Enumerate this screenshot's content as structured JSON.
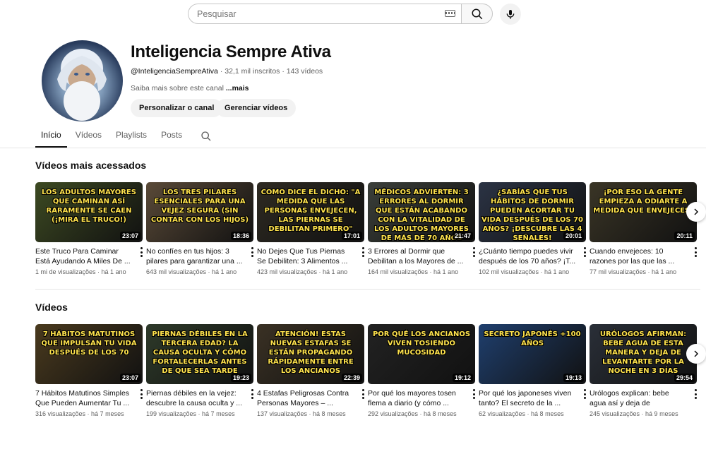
{
  "search": {
    "placeholder": "Pesquisar"
  },
  "channel": {
    "title": "Inteligencia Sempre Ativa",
    "handle": "@InteligenciaSempreAtiva",
    "subscribers": "32,1 mil inscritos",
    "videos_count": "143 vídeos",
    "description": "Saiba mais sobre este canal",
    "more": "...mais",
    "customize_button": "Personalizar o canal",
    "manage_button": "Gerenciar vídeos"
  },
  "tabs": [
    {
      "label": "Início",
      "active": true
    },
    {
      "label": "Vídeos",
      "active": false
    },
    {
      "label": "Playlists",
      "active": false
    },
    {
      "label": "Posts",
      "active": false
    }
  ],
  "sections": [
    {
      "title": "Vídeos mais acessados",
      "videos": [
        {
          "thumb_text": "Los adultos mayores que caminan así raramente se caen (¡mira el truco!)",
          "duration": "23:07",
          "title": "Este Truco Para Caminar Está Ayudando A Miles De ...",
          "views": "1 mi de visualizações",
          "age": "há 1 ano",
          "bg": "#3d4a22"
        },
        {
          "thumb_text": "Los tres pilares esenciales para una vejez segura (sin contar con los hijos)",
          "duration": "18:36",
          "title": "No confíes en tus hijos: 3 pilares para garantizar una ...",
          "views": "643 mil visualizações",
          "age": "há 1 ano",
          "bg": "#5a4a38"
        },
        {
          "thumb_text": "Como dice el dicho: \"A medida que las personas envejecen, las piernas se debilitan primero\"",
          "duration": "17:01",
          "title": "No Dejes Que Tus Piernas Se Debiliten: 3 Alimentos ...",
          "views": "423 mil visualizações",
          "age": "há 1 ano",
          "bg": "#2e2a22"
        },
        {
          "thumb_text": "Médicos advierten: 3 errores al dormir que están acabando con la vitalidad de los adultos mayores de más de 70 años",
          "duration": "21:47",
          "title": "3 Errores al Dormir que Debilitan a los Mayores de ...",
          "views": "164 mil visualizações",
          "age": "há 1 ano",
          "bg": "#3b3f3a"
        },
        {
          "thumb_text": "¿Sabías que tus hábitos de dormir pueden acortar tu vida después de los 70 años? ¡Descubre las 4 señales!",
          "duration": "20:01",
          "title": "¿Cuánto tiempo puedes vivir después de los 70 años? ¡T...",
          "views": "102 mil visualizações",
          "age": "há 1 ano",
          "bg": "#2b3344"
        },
        {
          "thumb_text": "¡Por eso la gente empieza a odiarte a medida que envejeces!",
          "duration": "20:11",
          "title": "Cuando envejeces: 10 razones por las que las ...",
          "views": "77 mil visualizações",
          "age": "há 1 ano",
          "bg": "#3a3526"
        }
      ]
    },
    {
      "title": "Vídeos",
      "videos": [
        {
          "thumb_text": "7 hábitos matutinos que impulsan tu vida después de los 70",
          "duration": "23:07",
          "title": "7 Hábitos Matutinos Simples Que Pueden Aumentar Tu ...",
          "views": "316 visualizações",
          "age": "há 7 meses",
          "bg": "#4a3a1e"
        },
        {
          "thumb_text": "Piernas débiles en la tercera edad? La causa oculta y cómo fortalecerlas antes de que sea tarde",
          "duration": "19:23",
          "title": "Piernas débiles en la vejez: descubre la causa oculta y ...",
          "views": "199 visualizações",
          "age": "há 7 meses",
          "bg": "#2e3a2a"
        },
        {
          "thumb_text": "Atención! Estas nuevas estafas se están propagando rápidamente entre los ancianos",
          "duration": "22:39",
          "title": "4 Estafas Peligrosas Contra Personas Mayores – ...",
          "views": "137 visualizações",
          "age": "há 8 meses",
          "bg": "#3a3124"
        },
        {
          "thumb_text": "Por qué los ancianos viven tosiendo mucosidad",
          "duration": "19:12",
          "title": "Por qué los mayores tosen flema a diario (y cómo ...",
          "views": "292 visualizações",
          "age": "há 8 meses",
          "bg": "#222222"
        },
        {
          "thumb_text": "Secreto japonés +100 años",
          "duration": "19:13",
          "title": "Por qué los japoneses viven tanto? El secreto de la ...",
          "views": "62 visualizações",
          "age": "há 8 meses",
          "bg": "#1f3f6e"
        },
        {
          "thumb_text": "Urólogos afirman: bebe agua de esta manera y deja de levantarte por la noche en 3 días",
          "duration": "29:54",
          "title": "Urólogos explican: bebe agua así y deja de despertarte po...",
          "views": "245 visualizações",
          "age": "há 9 meses",
          "bg": "#2a2f38"
        }
      ]
    }
  ]
}
